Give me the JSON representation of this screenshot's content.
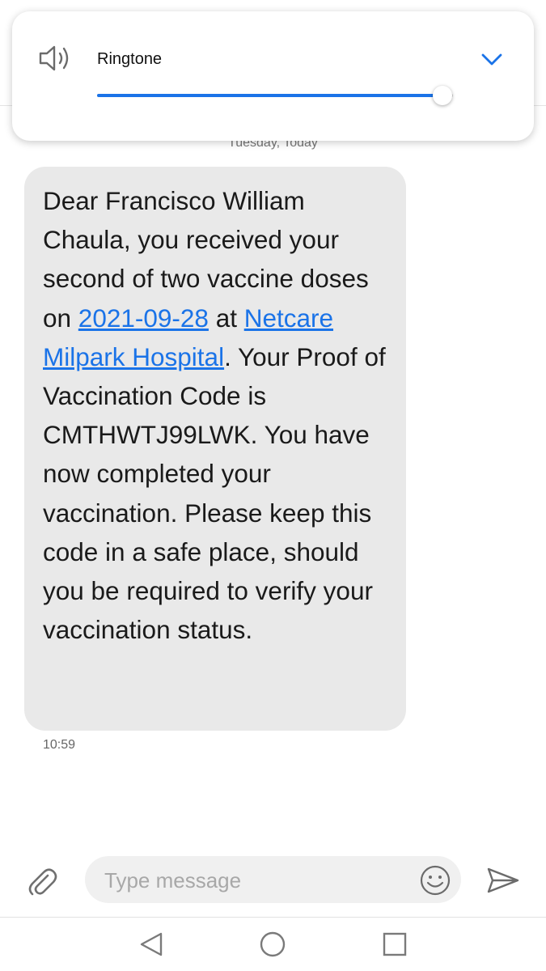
{
  "volume_panel": {
    "label": "Ringtone",
    "volume_fraction": 0.97,
    "accent_color": "#1a73e8",
    "icons": [
      "speaker-icon",
      "chevron-down-icon"
    ]
  },
  "conversation": {
    "date_separator": "Tuesday, Today",
    "message": {
      "part1": "Dear Francisco William Chaula, you received your second of two vaccine doses on ",
      "date_link": "2021-09-28",
      "part2": " at ",
      "location_link": "Netcare Milpark Hospital",
      "part3": ". Your Proof of Vaccination Code is CMTHWTJ99LWK. You have now completed your vaccination. Please keep this code in a safe place, should you be required to verify your vaccination status.",
      "time": "10:59"
    }
  },
  "compose": {
    "placeholder": "Type message",
    "icons": [
      "paperclip-icon",
      "emoji-icon",
      "send-icon"
    ]
  },
  "nav_bar": {
    "icons": [
      "back-icon",
      "home-icon",
      "recents-icon"
    ]
  }
}
